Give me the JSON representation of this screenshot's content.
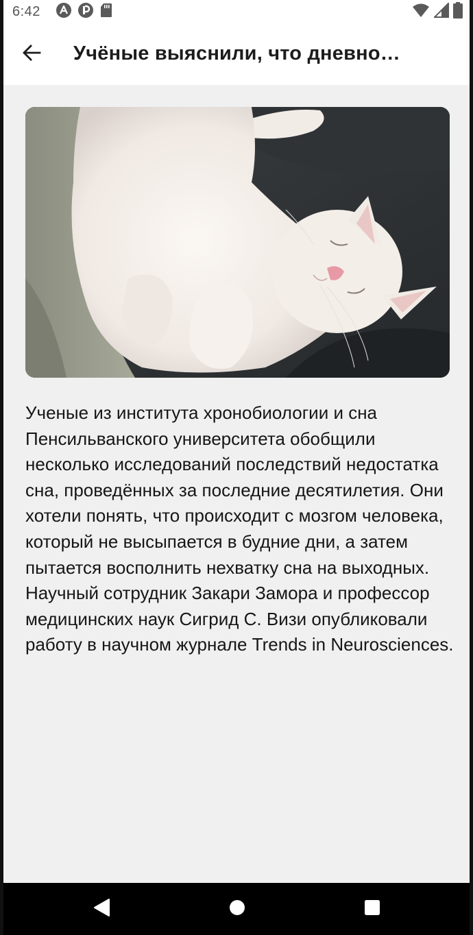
{
  "status_bar": {
    "time": "6:42",
    "left_icons": [
      "a-circle-icon",
      "p-circle-icon",
      "sd-card-icon"
    ],
    "right_icons": [
      "wifi-icon",
      "signal-icon",
      "battery-icon"
    ]
  },
  "app_bar": {
    "back_icon": "arrow-left-icon",
    "title": "Учёные выяснили, что дневно…"
  },
  "article": {
    "image_icon": "sleeping-white-cat-photo",
    "body": "Ученые из института хронобиологии и сна Пенсильванского университета обобщили несколько исследований последствий недостатка сна, проведённых за последние десятилетия. Они хотели понять, что происходит с мозгом человека, который не высыпается в будние дни, а затем пытается восполнить нехватку сна на выходных. Научный сотрудник Закари Замора и профессор медицинских наук Сигрид С. Визи опубликовали работу в научном журнале Trends in Neurosciences."
  },
  "nav_bar": {
    "back_icon": "triangle-back-icon",
    "home_icon": "circle-home-icon",
    "recents_icon": "square-recents-icon"
  },
  "colors": {
    "status_bar_bg": "#ffffff",
    "app_bar_bg": "#ffffff",
    "content_bg": "#f0f0f0",
    "nav_bar_bg": "#000000",
    "text": "#161616"
  }
}
